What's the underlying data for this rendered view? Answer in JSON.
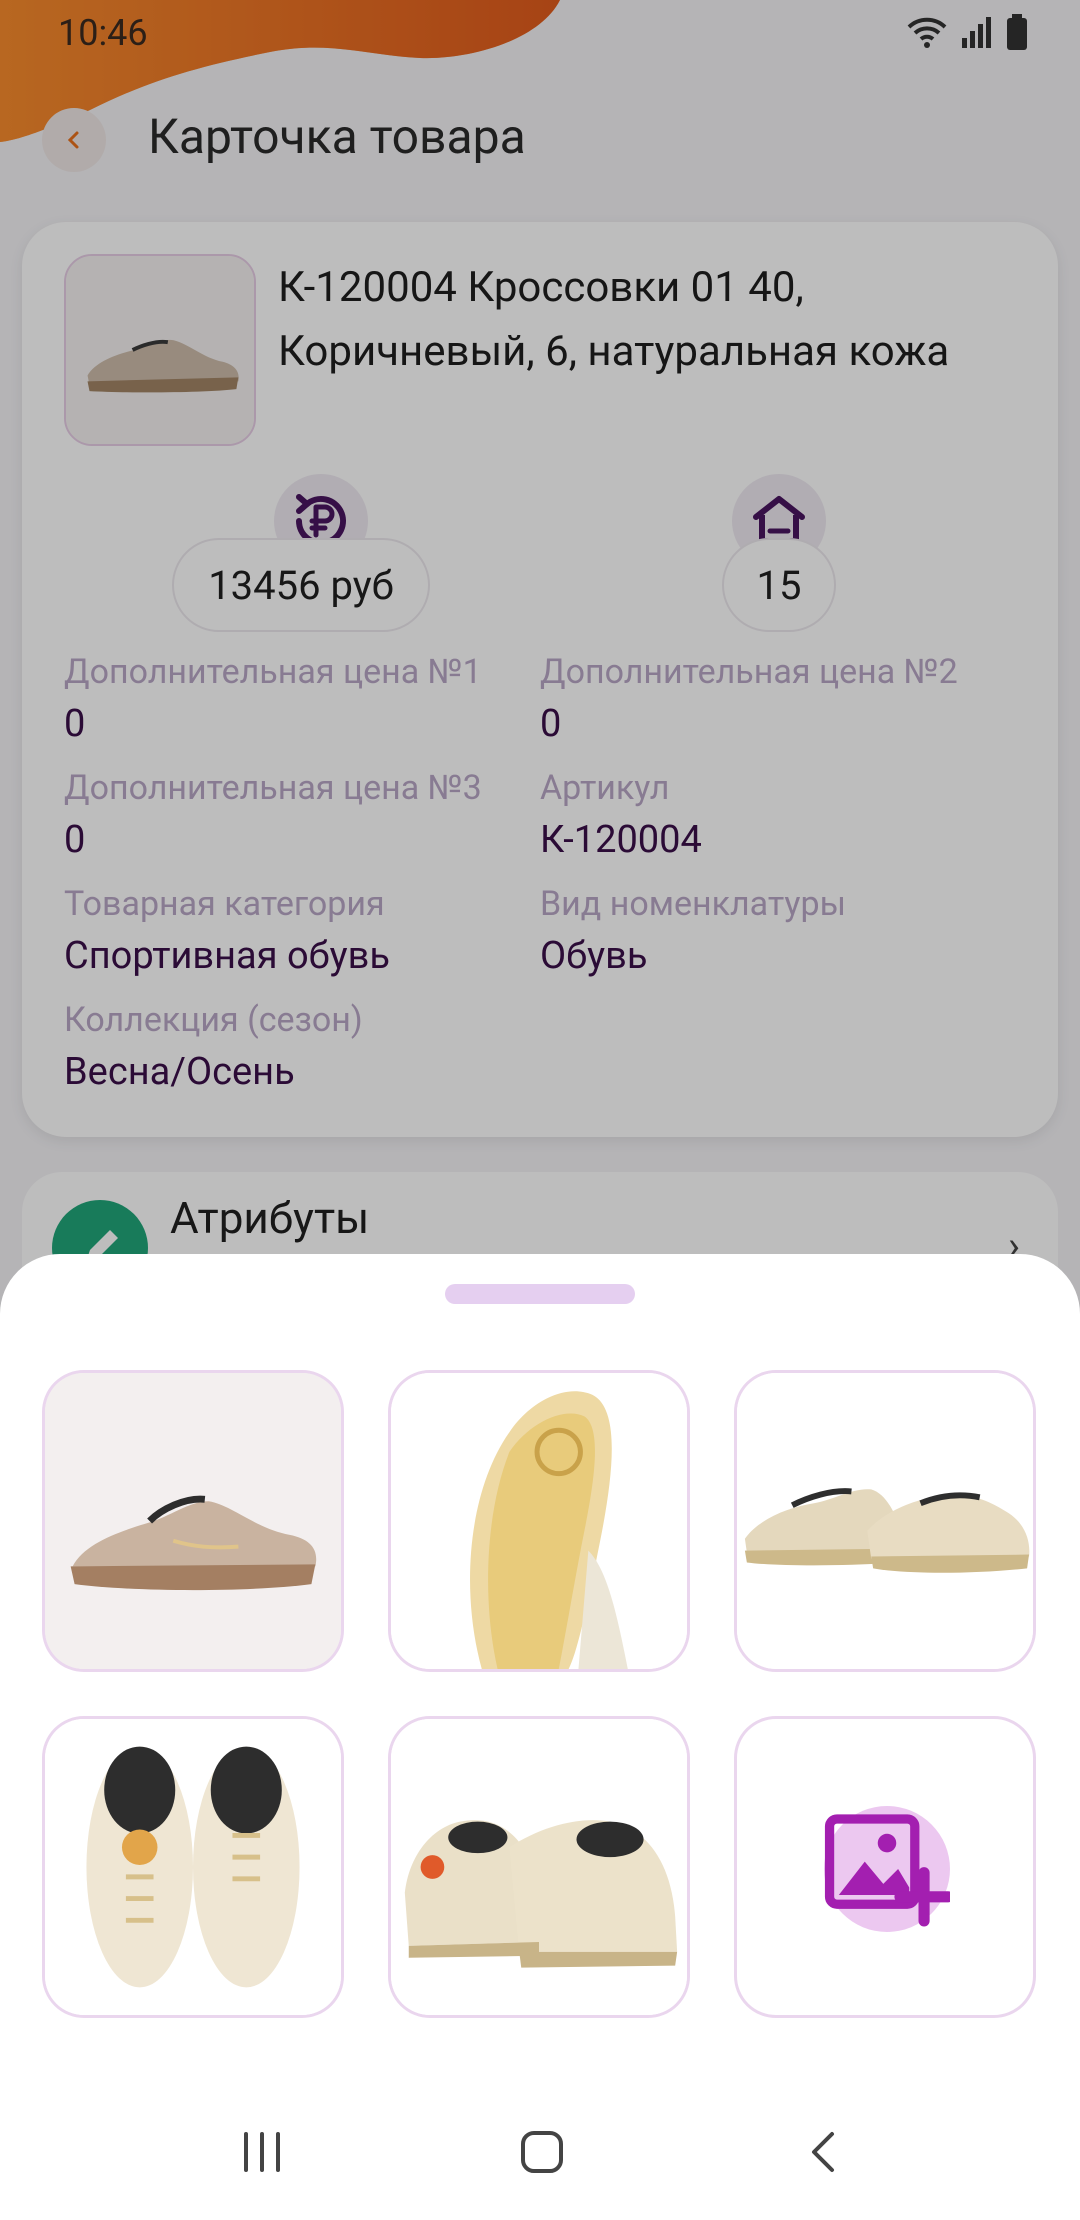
{
  "status_bar": {
    "time": "10:46"
  },
  "header": {
    "title": "Карточка товара"
  },
  "product": {
    "name": "К-120004 Кроссовки 01 40, Коричневый, 6, натуральная кожа",
    "price": "13456 руб",
    "stock": "15",
    "fields": [
      {
        "label": "Дополнительная цена №1",
        "value": "0"
      },
      {
        "label": "Дополнительная цена №2",
        "value": "0"
      },
      {
        "label": "Дополнительная цена №3",
        "value": "0"
      },
      {
        "label": "Артикул",
        "value": "К-120004"
      },
      {
        "label": "Товарная категория",
        "value": "Спортивная обувь"
      },
      {
        "label": "Вид номенклатуры",
        "value": "Обувь"
      },
      {
        "label": "Коллекция (сезон)",
        "value": "Весна/Осень"
      }
    ]
  },
  "attributes": {
    "title": "Атрибуты"
  },
  "photos": [
    {
      "icon": "shoe-side-icon"
    },
    {
      "icon": "shoe-sole-icon"
    },
    {
      "icon": "shoe-pair-icon"
    },
    {
      "icon": "shoe-top-icon"
    },
    {
      "icon": "shoe-back-icon"
    }
  ],
  "add_photo": {
    "icon": "add-image-icon"
  },
  "colors": {
    "accent": "#5a1d6e",
    "overlay": "#000000",
    "add_button": "#ecc8f0",
    "status_orange": "#e8711c"
  }
}
